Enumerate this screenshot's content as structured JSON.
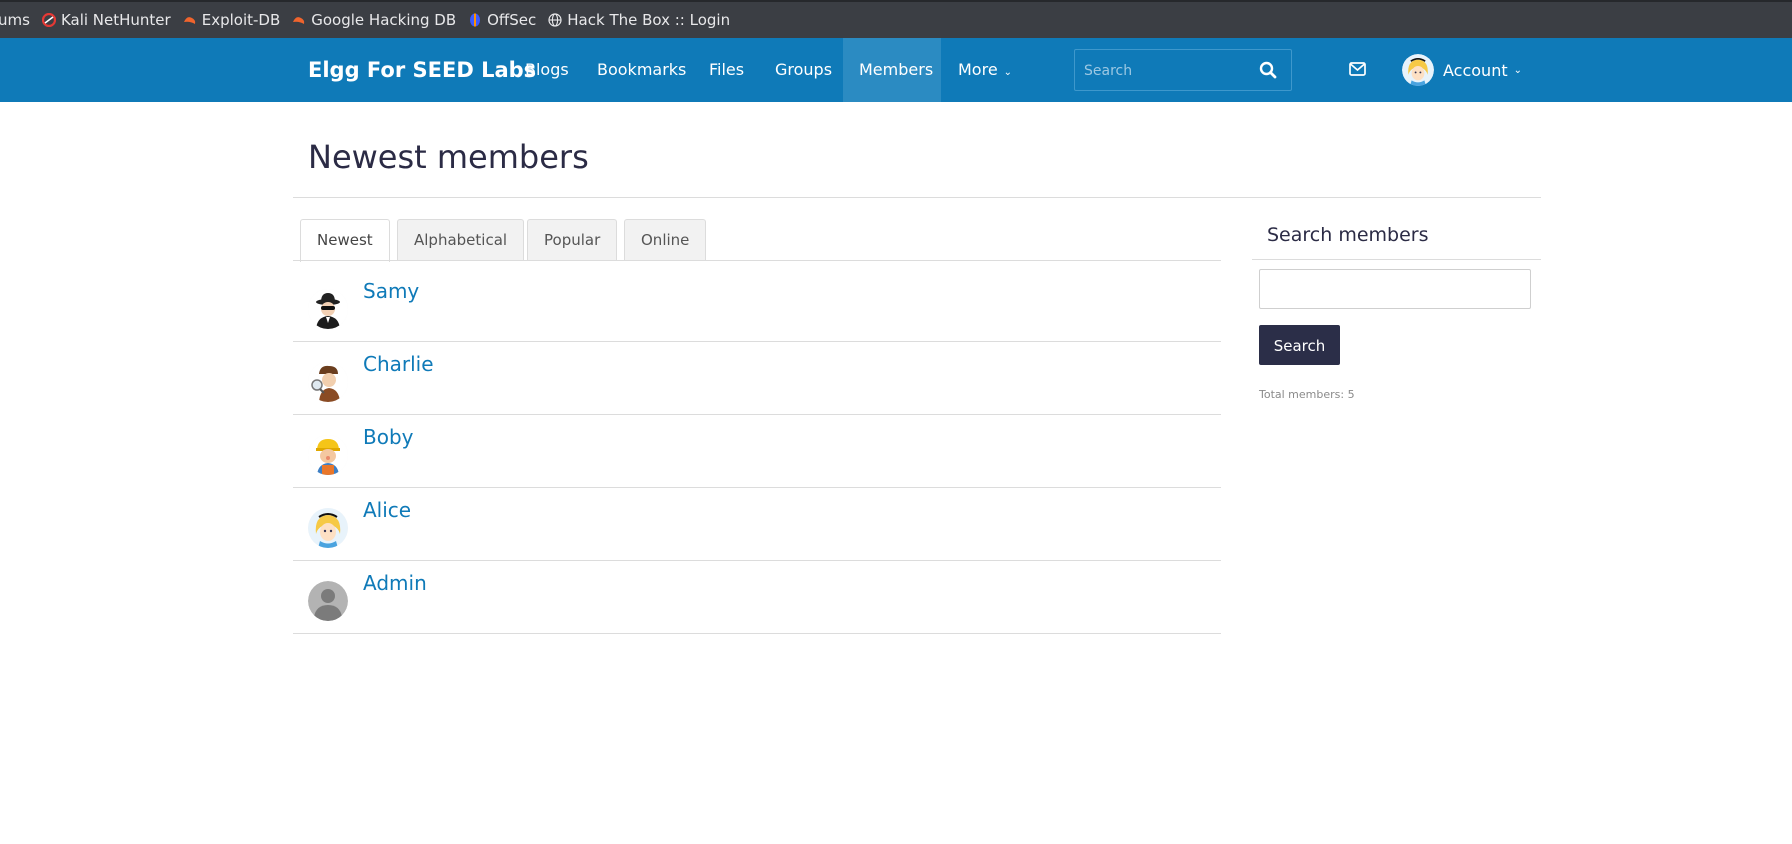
{
  "bookmarks": [
    {
      "label": "ums",
      "icon": "none"
    },
    {
      "label": "Kali NetHunter",
      "icon": "kali-nethunter-icon"
    },
    {
      "label": "Exploit-DB",
      "icon": "exploit-db-icon"
    },
    {
      "label": "Google Hacking DB",
      "icon": "exploit-db-icon"
    },
    {
      "label": "OffSec",
      "icon": "offsec-icon"
    },
    {
      "label": "Hack The Box :: Login",
      "icon": "globe-icon"
    }
  ],
  "nav": {
    "brand": "Elgg For SEED Labs",
    "items": [
      {
        "label": "Blogs"
      },
      {
        "label": "Bookmarks"
      },
      {
        "label": "Files"
      },
      {
        "label": "Groups"
      },
      {
        "label": "Members",
        "active": true
      },
      {
        "label": "More"
      }
    ],
    "search_placeholder": "Search",
    "account_label": "Account"
  },
  "page": {
    "title": "Newest members",
    "tabs": [
      {
        "label": "Newest",
        "active": true
      },
      {
        "label": "Alphabetical"
      },
      {
        "label": "Popular"
      },
      {
        "label": "Online"
      }
    ],
    "members": [
      {
        "name": "Samy",
        "avatar": "spy-avatar"
      },
      {
        "name": "Charlie",
        "avatar": "detective-avatar"
      },
      {
        "name": "Boby",
        "avatar": "builder-avatar"
      },
      {
        "name": "Alice",
        "avatar": "alice-avatar"
      },
      {
        "name": "Admin",
        "avatar": "default-avatar"
      }
    ]
  },
  "sidebar": {
    "title": "Search members",
    "button_label": "Search",
    "total_members": "Total members: 5"
  },
  "colors": {
    "topbar": "#0f7ab8",
    "active_nav": "#2b8bc2",
    "link": "#0f7ab8",
    "button": "#2b2e48",
    "bookmarks_bar": "#3b3e44"
  }
}
